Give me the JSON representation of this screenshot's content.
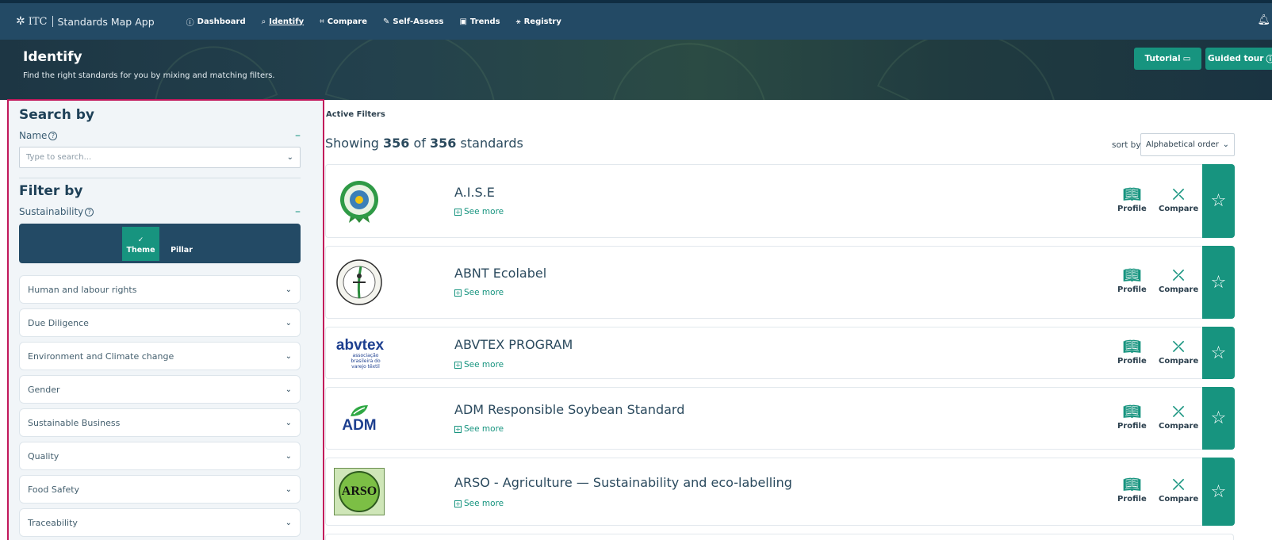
{
  "app": {
    "brand": "ITC",
    "name": "Standards Map App"
  },
  "nav": [
    {
      "label": "Dashboard",
      "icon": "info-circle-icon",
      "glyph": "ⓘ"
    },
    {
      "label": "Identify",
      "icon": "search-icon",
      "glyph": "⌕"
    },
    {
      "label": "Compare",
      "icon": "compare-icon",
      "glyph": "⌗"
    },
    {
      "label": "Self-Assess",
      "icon": "edit-icon",
      "glyph": "✎"
    },
    {
      "label": "Trends",
      "icon": "trends-icon",
      "glyph": "▣"
    },
    {
      "label": "Registry",
      "icon": "network-icon",
      "glyph": "⚹"
    }
  ],
  "hero": {
    "title": "Identify",
    "subtitle": "Find the right standards for you by mixing and matching filters.",
    "tutorial_label": "Tutorial",
    "guided_tour_label": "Guided tour"
  },
  "sidebar": {
    "search_heading": "Search by",
    "name_label": "Name",
    "search_placeholder": "Type to search...",
    "filter_heading": "Filter by",
    "sustainability_label": "Sustainability",
    "toggle": {
      "on": "Theme",
      "off": "Pillar"
    },
    "themes": [
      "Human and labour rights",
      "Due Diligence",
      "Environment and Climate change",
      "Gender",
      "Sustainable Business",
      "Quality",
      "Food Safety",
      "Traceability"
    ]
  },
  "results": {
    "active_filters": "Active Filters",
    "showing_prefix": "Showing",
    "shown": "356",
    "of_word": "of",
    "total": "356",
    "suffix": "standards",
    "sort_label": "sort by",
    "sort_value": "Alphabetical order",
    "see_more_label": "See more",
    "profile_label": "Profile",
    "compare_label": "Compare",
    "standards": [
      {
        "name": "A.I.S.E",
        "logo": "aise-logo"
      },
      {
        "name": "ABNT Ecolabel",
        "logo": "abnt-logo"
      },
      {
        "name": "ABVTEX PROGRAM",
        "logo": "abvtex-logo",
        "logo_text": "abvtex",
        "logo_sub": "associação brasileira do varejo têxtil"
      },
      {
        "name": "ADM Responsible Soybean Standard",
        "logo": "adm-logo",
        "logo_text": "ADM"
      },
      {
        "name": "ARSO - Agriculture — Sustainability and eco-labelling",
        "logo": "arso-logo",
        "logo_text": "ARSO"
      }
    ]
  },
  "colors": {
    "nav_bg": "#234a65",
    "accent": "#17947f",
    "sidebar_border": "#c2185b"
  }
}
